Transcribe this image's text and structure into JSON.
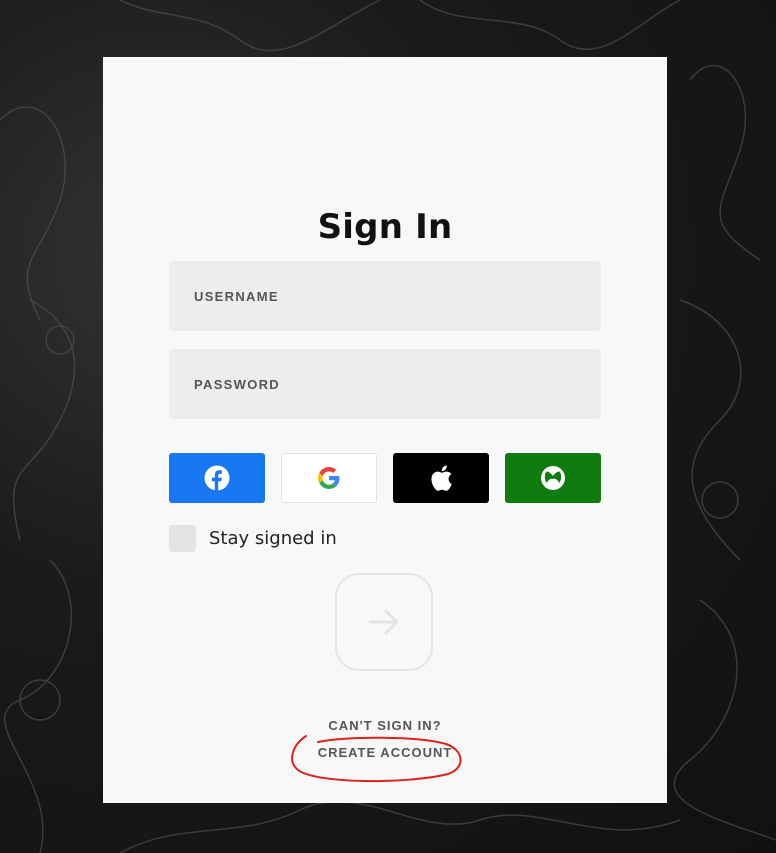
{
  "signin": {
    "title": "Sign In",
    "username_label": "USERNAME",
    "password_label": "PASSWORD",
    "social": [
      {
        "name": "facebook",
        "icon": "facebook-icon",
        "color": "#1877f2"
      },
      {
        "name": "google",
        "icon": "google-icon",
        "color": "#ffffff"
      },
      {
        "name": "apple",
        "icon": "apple-icon",
        "color": "#000000"
      },
      {
        "name": "xbox",
        "icon": "xbox-icon",
        "color": "#107c10"
      }
    ],
    "stay_signed_in": "Stay signed in",
    "stay_signed_in_checked": false,
    "submit_icon": "arrow-right-icon",
    "cant_sign_in": "CAN'T SIGN IN?",
    "create_account": "CREATE ACCOUNT"
  },
  "annotation": {
    "color": "#e0201a",
    "target": "create-account-link"
  }
}
